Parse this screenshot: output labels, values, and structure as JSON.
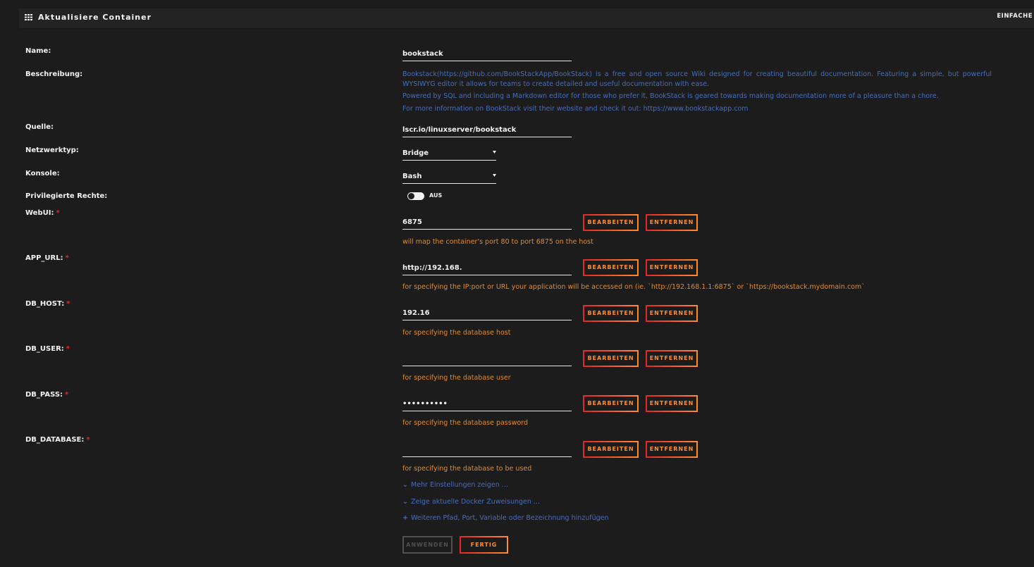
{
  "header": {
    "title": "Aktualisiere Container",
    "mode_link": "EINFACHE"
  },
  "fields": {
    "name": {
      "label": "Name:",
      "value": "bookstack"
    },
    "description": {
      "label": "Beschreibung:",
      "lines": [
        "Bookstack(https://github.com/BookStackApp/BookStack) is a free and open source Wiki designed for creating beautiful documentation. Featuring a simple, but powerful WYSIWYG editor it allows for teams to create detailed and useful documentation with ease.",
        "Powered by SQL and including a Markdown editor for those who prefer it, BookStack is geared towards making documentation more of a pleasure than a chore.",
        "For more information on BookStack visit their website and check it out: https://www.bookstackapp.com"
      ]
    },
    "source": {
      "label": "Quelle:",
      "value": "lscr.io/linuxserver/bookstack"
    },
    "network": {
      "label": "Netzwerktyp:",
      "value": "Bridge"
    },
    "console": {
      "label": "Konsole:",
      "value": "Bash"
    },
    "privileged": {
      "label": "Privilegierte Rechte:",
      "state": "AUS"
    }
  },
  "params": [
    {
      "label": "WebUI:",
      "value": "6875",
      "hint": "will map the container's port 80 to port 6875 on the host"
    },
    {
      "label": "APP_URL:",
      "value": "http://192.168.",
      "hint": "for specifying the IP:port or URL your application will be accessed on (ie. `http://192.168.1.1:6875` or `https://bookstack.mydomain.com`"
    },
    {
      "label": "DB_HOST:",
      "value": "192.16",
      "hint": "for specifying the database host"
    },
    {
      "label": "DB_USER:",
      "value": "",
      "hint": "for specifying the database user"
    },
    {
      "label": "DB_PASS:",
      "value": "••••••••••",
      "hint": "for specifying the database password"
    },
    {
      "label": "DB_DATABASE:",
      "value": "",
      "hint": "for specifying the database to be used"
    }
  ],
  "param_buttons": {
    "edit": "BEARBEITEN",
    "remove": "ENTFERNEN"
  },
  "links": {
    "more_settings": "Mehr Einstellungen zeigen ...",
    "docker_mappings": "Zeige aktuelle Docker Zuweisungen ...",
    "add_more": "Weiteren Pfad, Port, Variable oder Bezeichnung hinzufügen"
  },
  "footer": {
    "apply": "ANWENDEN",
    "done": "FERTIG"
  },
  "colors": {
    "background": "#1c1c1c",
    "link_blue": "#486dbd",
    "hint_orange": "#e68a2c",
    "button_gradient_start": "#e22828",
    "button_gradient_end": "#ff8c2f"
  }
}
